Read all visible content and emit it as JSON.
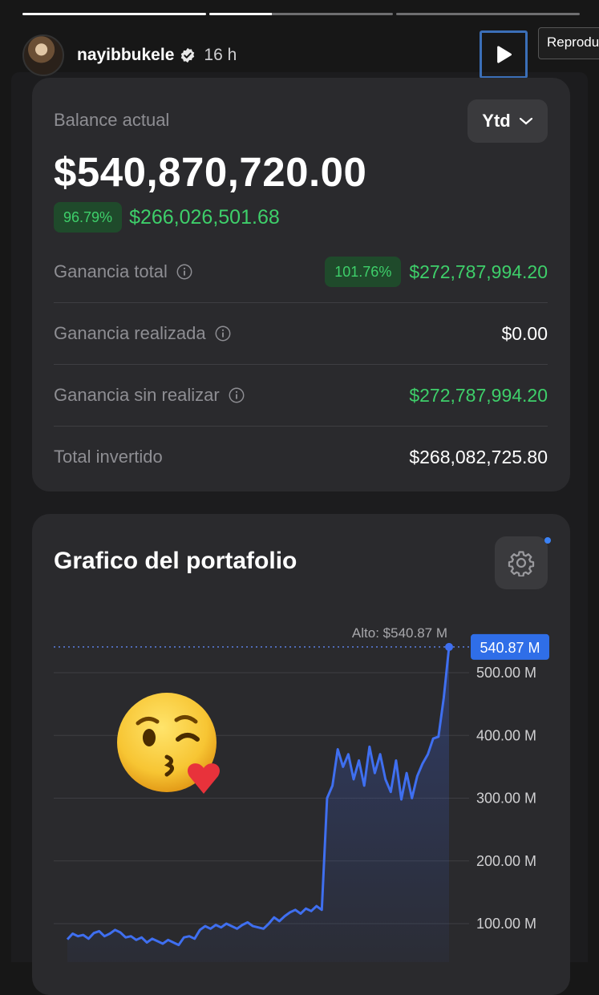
{
  "story": {
    "progress": [
      1.0,
      0.34,
      0.0
    ],
    "username": "nayibbukele",
    "time_ago": "16 h",
    "tooltip": "Reprodu"
  },
  "balance": {
    "label": "Balance actual",
    "period": "Ytd",
    "amount": "$540,870,720.00",
    "change_pct": "96.79%",
    "change_value": "$266,026,501.68",
    "rows": [
      {
        "label": "Ganancia total",
        "pct": "101.76%",
        "value": "$272,787,994.20"
      },
      {
        "label": "Ganancia realizada",
        "value": "$0.00"
      },
      {
        "label": "Ganancia sin realizar",
        "value": "$272,787,994.20"
      },
      {
        "label": "Total invertido",
        "value": "$268,082,725.80"
      }
    ]
  },
  "portfolio": {
    "title": "Grafico del portafolio",
    "settings_icon": "gear-icon",
    "sticker": "kissing-face-with-heart-emoji"
  },
  "colors": {
    "accent": "#3b82f6",
    "positive": "#3ecf6a",
    "card": "#2a2a2d"
  },
  "chart_data": {
    "type": "area",
    "high_label": "Alto: $540.87 M",
    "current_label": "540.87 M",
    "y_ticks": [
      "500.00 M",
      "400.00 M",
      "300.00 M",
      "200.00 M",
      "100.00 M"
    ],
    "y_tick_values": [
      500,
      400,
      300,
      200,
      100
    ],
    "ylim": [
      60,
      560
    ],
    "series": [
      {
        "values": [
          75,
          84,
          80,
          82,
          76,
          85,
          88,
          80,
          84,
          90,
          86,
          78,
          80,
          74,
          78,
          70,
          76,
          72,
          68,
          74,
          70,
          66,
          78,
          80,
          76,
          90,
          96,
          92,
          98,
          94,
          100,
          96,
          92,
          98,
          102,
          96,
          94,
          92,
          100,
          110,
          104,
          112,
          118,
          122,
          116,
          124,
          120,
          128,
          122,
          300,
          320,
          378,
          350,
          370,
          330,
          360,
          320,
          382,
          340,
          370,
          330,
          310,
          360,
          298,
          340,
          300,
          335,
          355,
          370,
          395,
          398,
          460,
          541
        ]
      }
    ],
    "grid": true
  }
}
